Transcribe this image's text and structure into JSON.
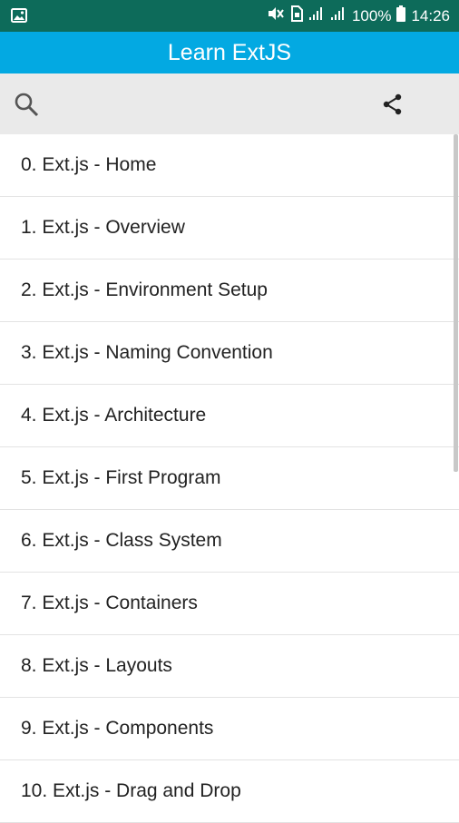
{
  "status_bar": {
    "battery": "100%",
    "time": "14:26",
    "icons": [
      "image-icon",
      "mute-icon",
      "sim-icon",
      "signal-icon",
      "signal-icon",
      "battery-icon"
    ]
  },
  "app_bar": {
    "title": "Learn ExtJS"
  },
  "toolbar": {
    "icons": [
      "search-icon",
      "share-icon"
    ]
  },
  "chapters": [
    {
      "label": "0. Ext.js - Home"
    },
    {
      "label": "1. Ext.js - Overview"
    },
    {
      "label": "2. Ext.js - Environment Setup"
    },
    {
      "label": "3. Ext.js - Naming Convention"
    },
    {
      "label": "4. Ext.js - Architecture"
    },
    {
      "label": "5. Ext.js - First Program"
    },
    {
      "label": "6. Ext.js - Class System"
    },
    {
      "label": "7. Ext.js - Containers"
    },
    {
      "label": "8. Ext.js - Layouts"
    },
    {
      "label": "9. Ext.js - Components"
    },
    {
      "label": "10. Ext.js - Drag and Drop"
    }
  ],
  "colors": {
    "status_bar": "#0d6b5a",
    "app_bar": "#03a9e2",
    "toolbar": "#eaeaea",
    "text": "#222222"
  }
}
